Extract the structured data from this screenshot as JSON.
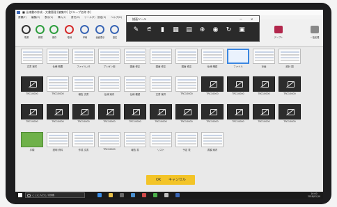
{
  "window": {
    "title": "■ 仕様書の作成 - 文書管理 [編集中]  [グループ名称 作]"
  },
  "menu": [
    "書類(F)",
    "編集(E)",
    "表示(V)",
    "挿入(I)",
    "書式(O)",
    "ツール(T)",
    "設定(S)",
    "ヘルプ(H)"
  ],
  "toolbar": [
    {
      "label": "電源",
      "color": "#333333"
    },
    {
      "label": "新規",
      "color": "#2e9e3e"
    },
    {
      "label": "保存",
      "color": "#2e9e3e"
    },
    {
      "label": "取消",
      "color": "#d52b2b"
    },
    {
      "label": "印刷",
      "color": "#3a66b5"
    },
    {
      "label": "画面表示",
      "color": "#3a66b5"
    },
    {
      "label": "設定",
      "color": "#3a66b5"
    }
  ],
  "float_toolbar": {
    "title": "描画ツール",
    "min": "—",
    "close": "✕",
    "icons": [
      "pen-icon",
      "marker-icon",
      "eraser-icon",
      "grid-icon",
      "tile-icon",
      "zoom-icon",
      "stamp-icon",
      "refresh-icon",
      "camera-icon"
    ]
  },
  "ribbon_right": [
    {
      "label": "テンプレ",
      "color": "#b2274c"
    },
    {
      "label": "一括処理",
      "color": "#888888"
    }
  ],
  "thumbnails": [
    {
      "kind": "doc",
      "label": "文書 案件"
    },
    {
      "kind": "doc",
      "label": "仕様 概要"
    },
    {
      "kind": "doc",
      "label": "ファイル_01"
    },
    {
      "kind": "doc",
      "label": "プレゼン用"
    },
    {
      "kind": "doc",
      "label": "図面 修正"
    },
    {
      "kind": "doc",
      "label": "図面 修正"
    },
    {
      "kind": "doc",
      "label": "図面 修正"
    },
    {
      "kind": "doc",
      "label": "仕様 確認"
    },
    {
      "kind": "sel",
      "label": "ファイル"
    },
    {
      "kind": "doc",
      "label": "計画"
    },
    {
      "kind": "doc",
      "label": "設計 図"
    },
    {
      "kind": "blank",
      "label": "TRC10000"
    },
    {
      "kind": "doc",
      "label": "TRC10000"
    },
    {
      "kind": "doc",
      "label": "報告 文書"
    },
    {
      "kind": "doc",
      "label": "仕様 案内"
    },
    {
      "kind": "doc",
      "label": "仕様 確認"
    },
    {
      "kind": "doc",
      "label": "文書 案件"
    },
    {
      "kind": "doc",
      "label": "TRC10000"
    },
    {
      "kind": "blank",
      "label": "TRC10000"
    },
    {
      "kind": "blank",
      "label": "TRC10000"
    },
    {
      "kind": "blank",
      "label": "TRC10000"
    },
    {
      "kind": "blank",
      "label": "TRC10000"
    },
    {
      "kind": "blank",
      "label": "TRC10000"
    },
    {
      "kind": "blank",
      "label": "TRC10000"
    },
    {
      "kind": "blank",
      "label": "TRC10000"
    },
    {
      "kind": "blank",
      "label": "TRC10000"
    },
    {
      "kind": "blank",
      "label": "TRC10000"
    },
    {
      "kind": "blank",
      "label": "TRC10000"
    },
    {
      "kind": "blank",
      "label": "TRC10000"
    },
    {
      "kind": "blank",
      "label": "TRC10000"
    },
    {
      "kind": "blank",
      "label": "TRC10000"
    },
    {
      "kind": "blank",
      "label": "TRC10000"
    },
    {
      "kind": "blank",
      "label": "TRC10000"
    },
    {
      "kind": "green",
      "label": "手順"
    },
    {
      "kind": "doc",
      "label": "説明 資料"
    },
    {
      "kind": "doc",
      "label": "作成 文書"
    },
    {
      "kind": "doc",
      "label": "TRC10000"
    },
    {
      "kind": "doc",
      "label": "報告 書"
    },
    {
      "kind": "doc",
      "label": "リスト"
    },
    {
      "kind": "doc",
      "label": "予定 表"
    },
    {
      "kind": "doc",
      "label": "書類 案内"
    }
  ],
  "buttons": {
    "primary": "OK",
    "secondary": "キャンセル"
  },
  "taskbar": {
    "search_placeholder": "ここに入力して検索",
    "icons": [
      "edge-icon",
      "folder-icon",
      "store-icon",
      "mail-icon",
      "media-icon",
      "chrome-icon",
      "app-icon",
      "word-icon"
    ],
    "time": "16:00",
    "date": "2018/01/10"
  }
}
